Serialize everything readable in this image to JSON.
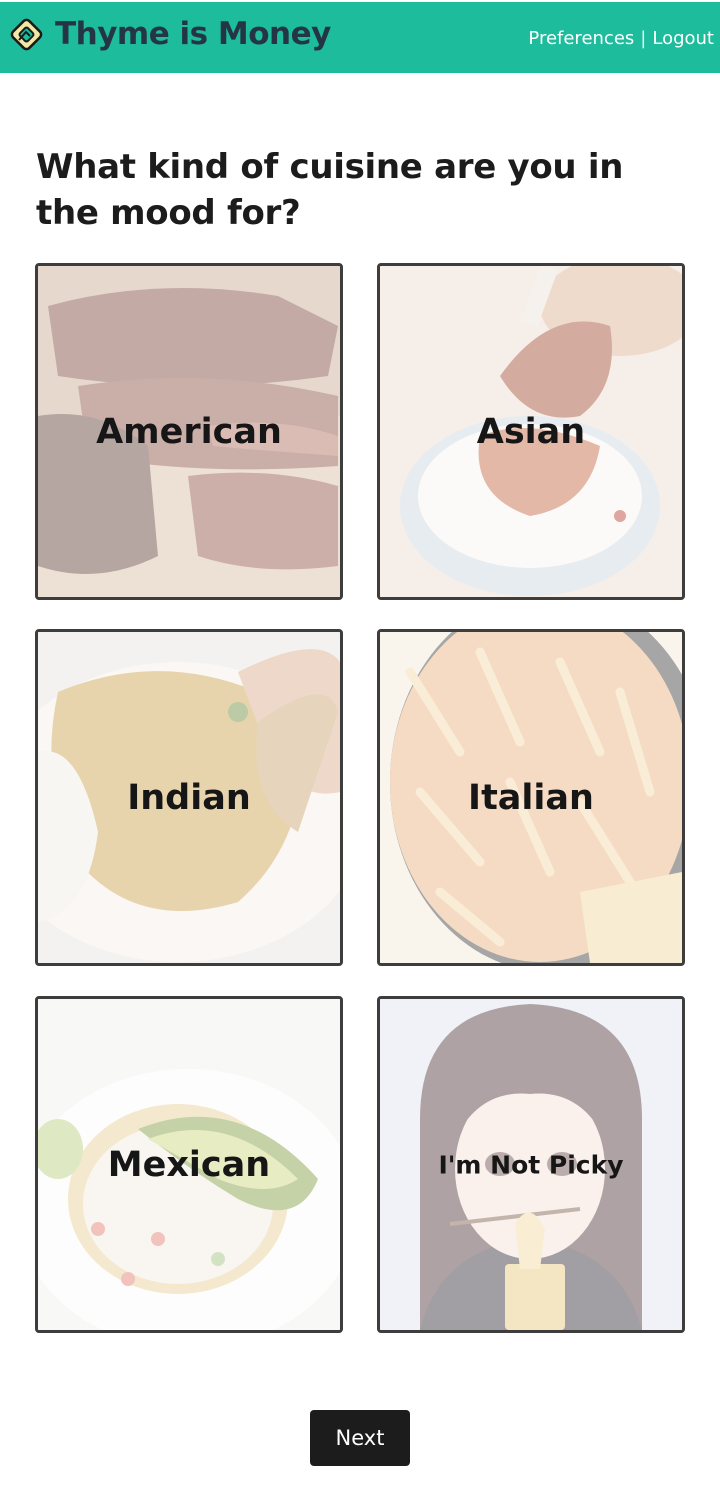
{
  "header": {
    "brand": "Thyme is Money",
    "logo_icon": "thyme-logo-icon",
    "links": {
      "preferences": "Preferences",
      "separator": "|",
      "logout": "Logout"
    },
    "background": "#1dbc9c",
    "brand_color": "#243644"
  },
  "main": {
    "question": "What kind of cuisine are you in the mood for?",
    "cuisines": [
      {
        "label": "American"
      },
      {
        "label": "Asian"
      },
      {
        "label": "Indian"
      },
      {
        "label": "Italian"
      },
      {
        "label": "Mexican"
      },
      {
        "label": "I'm Not Picky"
      }
    ],
    "next_label": "Next"
  }
}
